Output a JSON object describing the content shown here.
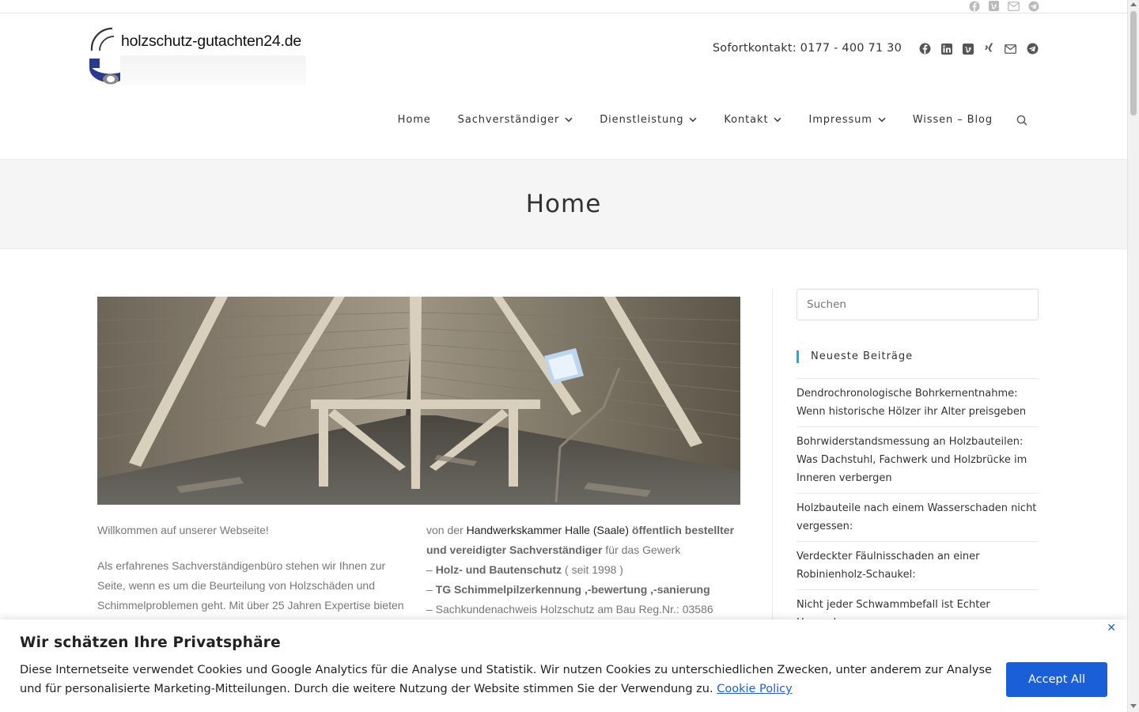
{
  "topbar": {
    "icons": [
      "facebook-icon",
      "vimeo-icon",
      "mail-icon",
      "telegram-icon"
    ]
  },
  "header": {
    "logo_text": "holzschutz-gutachten24.de",
    "contact": "Sofortkontakt: 0177 - 400 71 30",
    "social_icons": [
      "facebook-icon",
      "linkedin-icon",
      "vimeo-icon",
      "xing-icon",
      "mail-icon",
      "telegram-icon"
    ]
  },
  "nav": {
    "items": [
      {
        "label": "Home",
        "has_dropdown": false
      },
      {
        "label": "Sachverständiger",
        "has_dropdown": true
      },
      {
        "label": "Dienstleistung",
        "has_dropdown": true
      },
      {
        "label": "Kontakt",
        "has_dropdown": true
      },
      {
        "label": "Impressum",
        "has_dropdown": true
      },
      {
        "label": "Wissen – Blog",
        "has_dropdown": false
      }
    ]
  },
  "page": {
    "title": "Home"
  },
  "content": {
    "welcome": "Willkommen auf unserer Webseite!",
    "intro": "Als erfahrenes Sachverständigenbüro stehen wir Ihnen zur Seite, wenn es um die Beurteilung von Holzschäden und Schimmelproblemen geht. Mit über 25 Jahren Expertise bieten",
    "col2": {
      "prefix": "von der ",
      "chamber_link": "Handwerkskammer Halle (Saale)",
      "appointed": "öffentlich bestellter und vereidigter Sachverständiger",
      "trade_suffix": " für das Gewerk",
      "line1_dash": "– ",
      "line1_bold": "Holz- und Bautenschutz",
      "line1_rest": " ( seit 1998 )",
      "line2_dash": "– ",
      "line2_bold": "TG Schimmelpilzerkennung ,-bewertung ,-sanierung",
      "line3": "– Sachkundenachweis Holzschutz am Bau Reg.Nr.: 03586"
    }
  },
  "sidebar": {
    "search_placeholder": "Suchen",
    "widget_title": "Neueste Beiträge",
    "posts": [
      "Dendrochronologische Bohrkernentnahme: Wenn historische Hölzer ihr Alter preisgeben",
      "Bohrwiderstandsmessung an Holzbauteilen: Was Dachstuhl, Fachwerk und Holzbrücke im Inneren verbergen",
      "Holzbauteile nach einem Wasserschaden nicht vergessen:",
      "Verdeckter Fäulnisschaden an einer Robinienholz-Schaukel:",
      "Nicht jeder Schwammbefall ist Echter Hausschwamm:"
    ]
  },
  "cookie": {
    "title": "Wir schätzen Ihre Privatsphäre",
    "text": "Diese Internetseite verwendet Cookies und Google Analytics für die Analyse und Statistik. Wir nutzen Cookies zu unterschiedlichen Zwecken, unter anderem zur Analyse und für personalisierte Marketing-Mitteilungen. Durch die weitere Nutzung der Website stimmen Sie der Verwendung zu.",
    "policy_link": "Cookie Policy",
    "accept_label": "Accept All",
    "close_glyph": "✕"
  },
  "colors": {
    "accent": "#13aff0",
    "button": "#1a5fd8",
    "logo_blue": "#2a3a8f"
  }
}
